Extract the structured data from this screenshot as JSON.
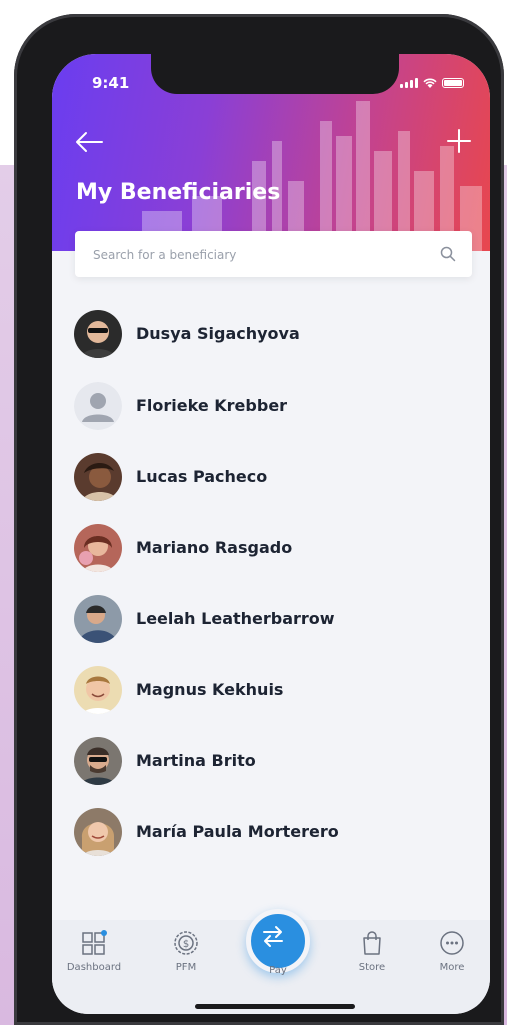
{
  "status_bar": {
    "time": "9:41"
  },
  "header": {
    "title": "My Beneficiaries"
  },
  "search": {
    "placeholder": "Search for a beneficiary"
  },
  "beneficiaries": [
    {
      "name": "Dusya Sigachyova",
      "avatar_color": "#2b2b2b"
    },
    {
      "name": "Florieke Krebber",
      "avatar_color": "#c9ccd3"
    },
    {
      "name": "Lucas Pacheco",
      "avatar_color": "#5a3b2e"
    },
    {
      "name": "Mariano Rasgado",
      "avatar_color": "#b5665a"
    },
    {
      "name": "Leelah Leatherbarrow",
      "avatar_color": "#4a5a6a"
    },
    {
      "name": "Magnus Kekhuis",
      "avatar_color": "#e9d7a8"
    },
    {
      "name": "Martina Brito",
      "avatar_color": "#6e6a66"
    },
    {
      "name": "María Paula Morterero",
      "avatar_color": "#b58a5e"
    }
  ],
  "tabs": [
    {
      "label": "Dashboard",
      "icon": "dashboard-icon"
    },
    {
      "label": "PFM",
      "icon": "pfm-icon"
    },
    {
      "label": "Pay",
      "icon": "transfer-icon"
    },
    {
      "label": "Store",
      "icon": "shopping-bag-icon"
    },
    {
      "label": "More",
      "icon": "more-icon"
    }
  ],
  "colors": {
    "accent": "#2a8fe0",
    "header_start": "#6a3df0",
    "header_end": "#e8474e",
    "notification_dot": "#2a8fe0"
  }
}
